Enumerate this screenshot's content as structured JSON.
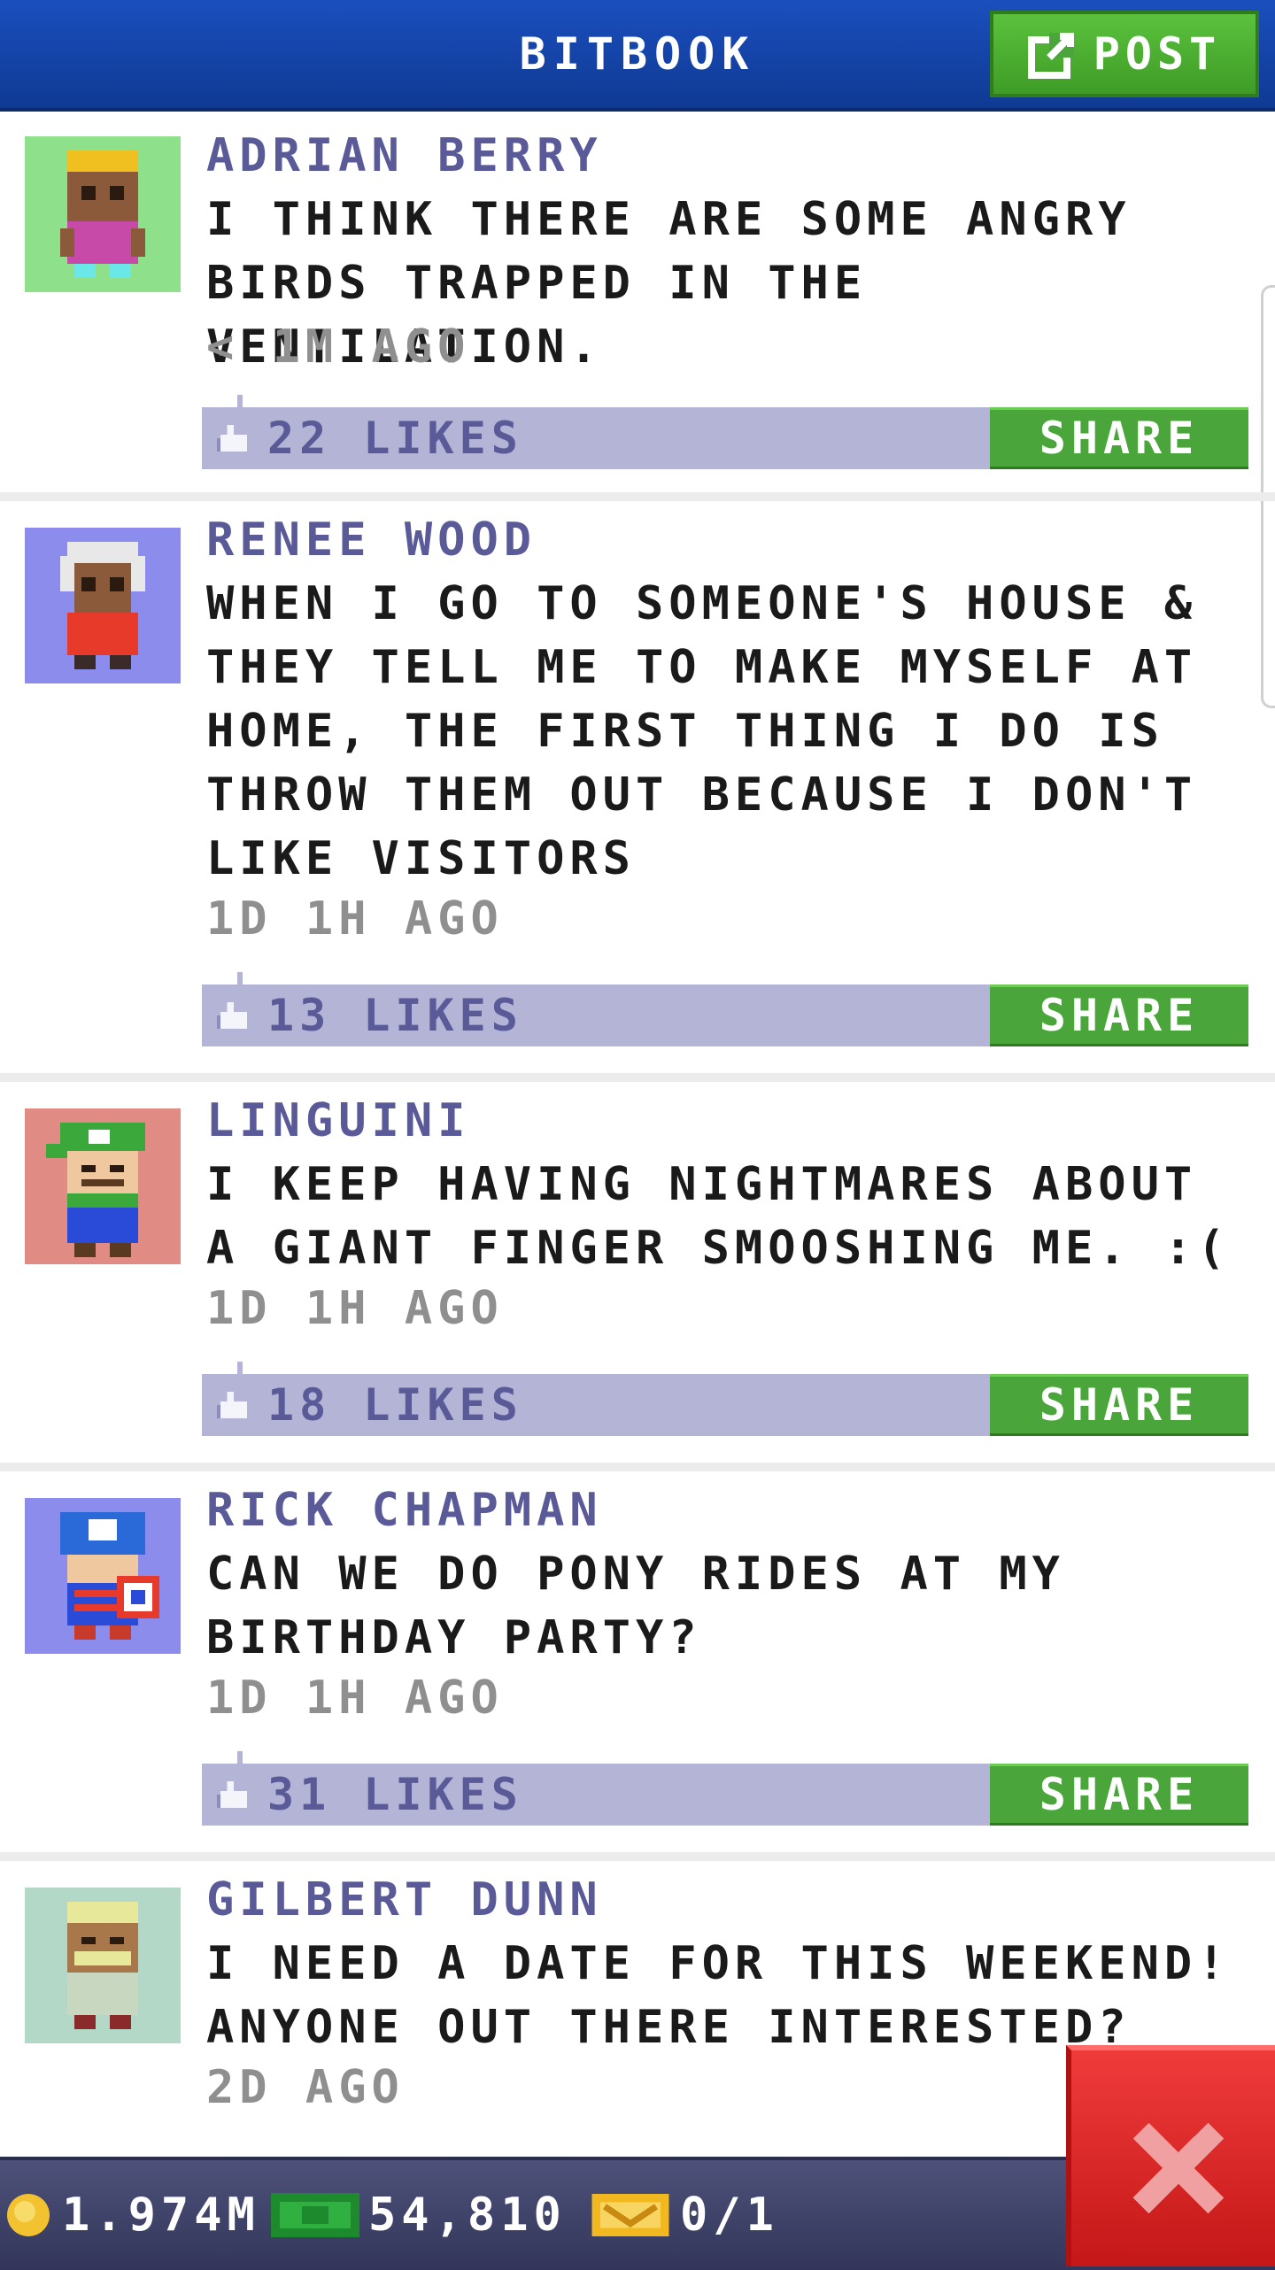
{
  "header": {
    "title": "BITBOOK",
    "post_label": "POST"
  },
  "posts": [
    {
      "author": "ADRIAN BERRY",
      "text": "I THINK THERE ARE SOME ANGRY BIRDS TRAPPED IN THE VENTILATION.",
      "time": "< 1M AGO",
      "likes": "22 LIKES",
      "share": "SHARE",
      "avatar_bg": "#8ee08a"
    },
    {
      "author": "RENEE WOOD",
      "text": " WHEN I GO TO SOMEONE'S HOUSE & THEY TELL ME TO MAKE MYSELF AT HOME, THE FIRST THING I DO IS THROW THEM OUT BECAUSE I DON'T LIKE VISITORS",
      "time": "1D 1H AGO",
      "likes": "13 LIKES",
      "share": "SHARE",
      "avatar_bg": "#8c8cec"
    },
    {
      "author": "LINGUINI",
      "text": "I KEEP HAVING NIGHTMARES ABOUT A GIANT FINGER SMOOSHING ME. :(",
      "time": "1D 1H AGO",
      "likes": "18 LIKES",
      "share": "SHARE",
      "avatar_bg": "#e08c84"
    },
    {
      "author": "RICK CHAPMAN",
      "text": "CAN WE DO PONY RIDES AT MY BIRTHDAY PARTY?",
      "time": "1D 1H AGO",
      "likes": "31 LIKES",
      "share": "SHARE",
      "avatar_bg": "#8c8cec"
    },
    {
      "author": "GILBERT DUNN",
      "text": "I NEED A DATE FOR THIS WEEKEND! ANYONE OUT THERE INTERESTED?",
      "time": "2D AGO",
      "likes": "",
      "share": "",
      "avatar_bg": "#b4d8c8"
    }
  ],
  "status": {
    "coins": "1.974M",
    "bux": "54,810",
    "tickets": "0/1"
  },
  "colors": {
    "header": "#1b4fbe",
    "share_green": "#4aa63a",
    "like_bar": "#b3b4d6",
    "author": "#5a5a99",
    "close_red": "#e02a2a"
  }
}
